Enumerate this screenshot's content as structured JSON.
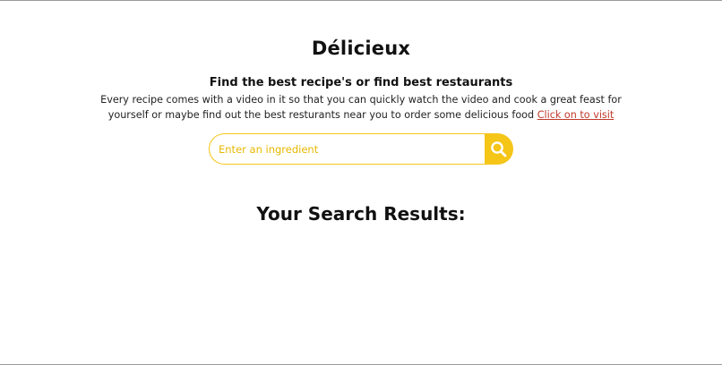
{
  "header": {
    "title": "Délicieux"
  },
  "intro": {
    "tagline": "Find the best recipe's or find best restaurants",
    "description": "Every recipe comes with a video in it so that you can quickly watch the video and cook a great feast for yourself or maybe find out the best resturants near you to order some delicious food",
    "link_label": "Click on to visit"
  },
  "search": {
    "placeholder": "Enter an ingredient",
    "value": "",
    "button_icon": "search-icon"
  },
  "results": {
    "heading": "Your Search Results:"
  },
  "colors": {
    "accent": "#f5c518",
    "link": "#c0392b",
    "text": "#111111"
  }
}
